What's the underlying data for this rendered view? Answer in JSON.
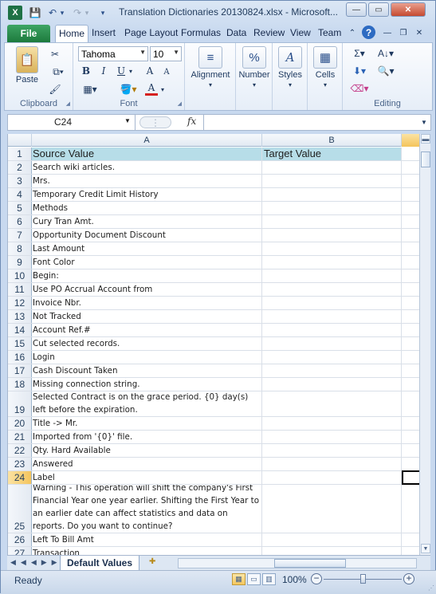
{
  "window": {
    "title": "Translation Dictionaries 20130824.xlsx - Microsoft...",
    "app_icon": "X",
    "controls": {
      "minimize": "—",
      "maximize": "▭",
      "close": "✕"
    }
  },
  "qat": {
    "save": "💾",
    "undo": "↶",
    "undo_dd": "▾",
    "redo": "↷",
    "redo_dd": "▾",
    "customize": "▾"
  },
  "ribbon_tabs": {
    "file": "File",
    "tabs": [
      "Home",
      "Insert",
      "Page Layout",
      "Formulas",
      "Data",
      "Review",
      "View",
      "Team"
    ],
    "help": "?"
  },
  "ribbon": {
    "clipboard": {
      "label": "Clipboard",
      "paste": "Paste"
    },
    "font": {
      "label": "Font",
      "name": "Tahoma",
      "size": "10",
      "bold": "B",
      "italic": "I",
      "underline": "U",
      "grow": "A",
      "shrink": "A",
      "font_color": "A"
    },
    "alignment": {
      "label": "Alignment"
    },
    "number": {
      "label": "Number",
      "icon": "%"
    },
    "styles": {
      "label": "Styles"
    },
    "cells": {
      "label": "Cells"
    },
    "editing": {
      "label": "Editing",
      "sum": "Σ"
    }
  },
  "formula_bar": {
    "name_box": "C24",
    "fx": "fx",
    "value": ""
  },
  "columns": [
    "A",
    "B"
  ],
  "header_row": {
    "num": "1",
    "a": "Source Value",
    "b": "Target Value"
  },
  "rows": [
    {
      "num": "2",
      "a": "Search wiki articles."
    },
    {
      "num": "3",
      "a": "Mrs."
    },
    {
      "num": "4",
      "a": "Temporary Credit Limit History"
    },
    {
      "num": "5",
      "a": "Methods"
    },
    {
      "num": "6",
      "a": "Cury Tran Amt."
    },
    {
      "num": "7",
      "a": "Opportunity Document Discount"
    },
    {
      "num": "8",
      "a": "Last Amount"
    },
    {
      "num": "9",
      "a": "Font Color"
    },
    {
      "num": "10",
      "a": "Begin:"
    },
    {
      "num": "11",
      "a": "Use PO Accrual Account from"
    },
    {
      "num": "12",
      "a": "Invoice Nbr."
    },
    {
      "num": "13",
      "a": "Not Tracked"
    },
    {
      "num": "14",
      "a": "Account Ref.#"
    },
    {
      "num": "15",
      "a": "Cut selected records."
    },
    {
      "num": "16",
      "a": "Login"
    },
    {
      "num": "17",
      "a": "Cash Discount Taken"
    },
    {
      "num": "18",
      "a": "Missing connection string."
    },
    {
      "num": "19",
      "a": "Selected Contract is on the grace period. {0} day(s) left before the expiration."
    },
    {
      "num": "20",
      "a": "Title -> Mr."
    },
    {
      "num": "21",
      "a": "Imported from '{0}' file."
    },
    {
      "num": "22",
      "a": "Qty. Hard Available"
    },
    {
      "num": "23",
      "a": "Answered"
    },
    {
      "num": "24",
      "a": "Label"
    },
    {
      "num": "25",
      "a": "Warning - This operation will shift the company's First Financial Year one year earlier. Shifting the First Year to an earlier date can affect statistics and data on reports. Do you want to continue?"
    },
    {
      "num": "26",
      "a": "Left To Bill Amt"
    },
    {
      "num": "27",
      "a": "Transaction"
    }
  ],
  "selected_row": "24",
  "sheet_tab": "Default Values",
  "status": {
    "ready": "Ready",
    "zoom": "100%",
    "zoom_minus": "−",
    "zoom_plus": "+"
  }
}
